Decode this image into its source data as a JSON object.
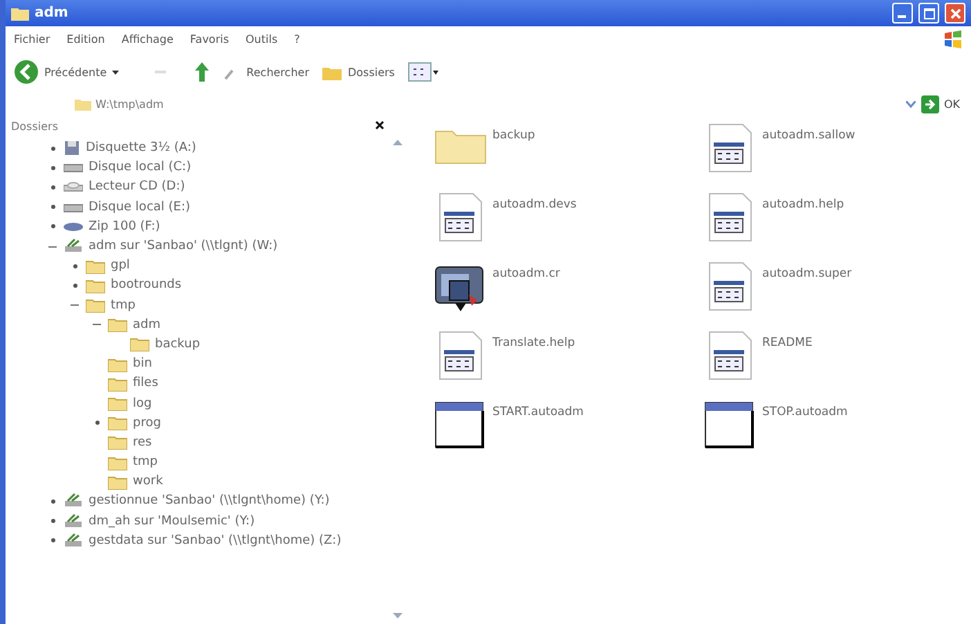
{
  "window": {
    "title": "adm"
  },
  "menu": [
    "Fichier",
    "Edition",
    "Affichage",
    "Favoris",
    "Outils",
    "?"
  ],
  "toolbar": {
    "back": "Précédente",
    "search": "Rechercher",
    "folders": "Dossiers"
  },
  "address": {
    "value": "W:\\tmp\\adm",
    "go": "OK"
  },
  "folder_pane": {
    "title": "Dossiers",
    "tree": [
      {
        "label": "Disquette 3½ (A:)",
        "kind": "floppy",
        "expanded": false
      },
      {
        "label": "Disque local (C:)",
        "kind": "drive",
        "expanded": false
      },
      {
        "label": "Lecteur CD (D:)",
        "kind": "cd",
        "expanded": false
      },
      {
        "label": "Disque local (E:)",
        "kind": "drive",
        "expanded": false
      },
      {
        "label": "Zip 100 (F:)",
        "kind": "zip",
        "expanded": false
      },
      {
        "label": "adm sur 'Sanbao' (\\\\tlgnt) (W:)",
        "kind": "network",
        "expanded": true,
        "children": [
          {
            "label": "gpl",
            "kind": "folder",
            "expanded": false
          },
          {
            "label": "bootrounds",
            "kind": "folder",
            "expanded": false
          },
          {
            "label": "tmp",
            "kind": "folder",
            "expanded": true,
            "children": [
              {
                "label": "adm",
                "kind": "folder",
                "expanded": true,
                "children": [
                  {
                    "label": "backup",
                    "kind": "folder"
                  }
                ]
              },
              {
                "label": "bin",
                "kind": "folder"
              },
              {
                "label": "files",
                "kind": "folder"
              },
              {
                "label": "log",
                "kind": "folder"
              },
              {
                "label": "prog",
                "kind": "folder",
                "expanded": false
              },
              {
                "label": "res",
                "kind": "folder"
              },
              {
                "label": "tmp",
                "kind": "folder"
              },
              {
                "label": "work",
                "kind": "folder"
              }
            ]
          }
        ]
      },
      {
        "label": "gestionnue 'Sanbao' (\\\\tlgnt\\home) (Y:)",
        "kind": "network",
        "expanded": false
      },
      {
        "label": "dm_ah sur 'Moulsemic' (Y:)",
        "kind": "network",
        "expanded": false
      },
      {
        "label": "gestdata sur 'Sanbao' (\\\\tlgnt\\home) (Z:)",
        "kind": "network",
        "expanded": false
      }
    ]
  },
  "files": [
    {
      "name": "backup",
      "kind": "folder"
    },
    {
      "name": "autoadm.sallow",
      "kind": "doc"
    },
    {
      "name": "autoadm.devs",
      "kind": "doc"
    },
    {
      "name": "autoadm.help",
      "kind": "doc"
    },
    {
      "name": "autoadm.cr",
      "kind": "app"
    },
    {
      "name": "autoadm.super",
      "kind": "doc"
    },
    {
      "name": "Translate.help",
      "kind": "doc"
    },
    {
      "name": "README",
      "kind": "doc"
    },
    {
      "name": "START.autoadm",
      "kind": "window"
    },
    {
      "name": "STOP.autoadm",
      "kind": "window"
    }
  ]
}
